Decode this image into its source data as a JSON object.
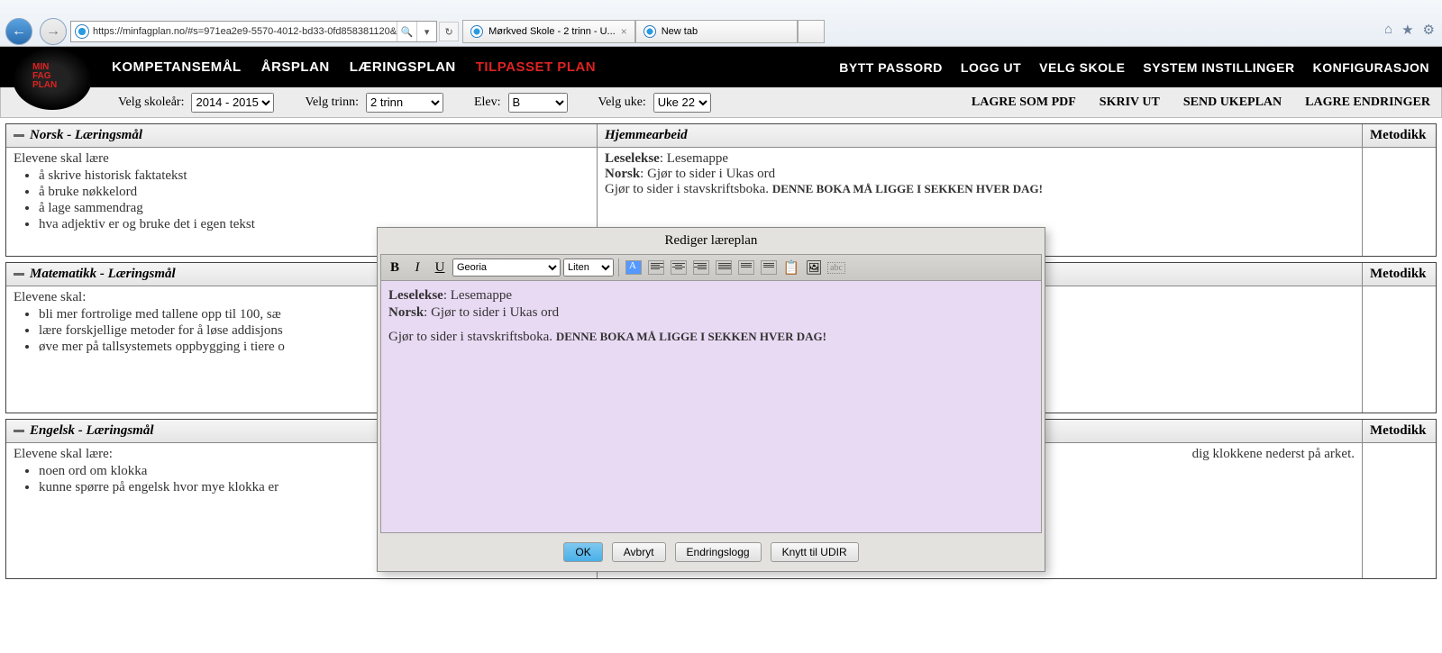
{
  "window": {
    "minimize": "–",
    "maximize": "❐",
    "close": "✕"
  },
  "browser": {
    "url": "https://minfagplan.no/#s=971ea2e9-5570-4012-bd33-0fd858381120&",
    "search_hint": "🔍",
    "tab1": "Mørkved Skole - 2 trinn - U...",
    "tab2": "New tab"
  },
  "nav": {
    "items": [
      "KOMPETANSEMÅL",
      "ÅRSPLAN",
      "LÆRINGSPLAN",
      "TILPASSET PLAN"
    ],
    "right": [
      "BYTT PASSORD",
      "LOGG UT",
      "VELG SKOLE",
      "SYSTEM INSTILLINGER",
      "KONFIGURASJON"
    ]
  },
  "filters": {
    "year_label": "Velg skoleår:",
    "year_value": "2014 - 2015",
    "trinn_label": "Velg trinn:",
    "trinn_value": "2 trinn",
    "elev_label": "Elev:",
    "elev_value": "B",
    "uke_label": "Velg uke:",
    "uke_value": "Uke 22",
    "right": [
      "LAGRE SOM PDF",
      "SKRIV UT",
      "SEND UKEPLAN",
      "LAGRE ENDRINGER"
    ]
  },
  "panels": {
    "norsk": {
      "title": "Norsk - Læringsmål",
      "hjemme": "Hjemmearbeid",
      "metodikk": "Metodikk",
      "intro": "Elevene skal lære",
      "items": [
        "å skrive historisk faktatekst",
        "å bruke nøkkelord",
        "å lage sammendrag",
        "hva adjektiv er og bruke det i egen tekst"
      ],
      "hjem_line1a": "Leselekse",
      "hjem_line1b": ": Lesemappe",
      "hjem_line2a": "Norsk",
      "hjem_line2b": ": Gjør to sider i Ukas ord",
      "hjem_line3a": "Gjør to sider i stavskriftsboka. ",
      "hjem_line3b": "DENNE BOKA MÅ LIGGE I SEKKEN HVER DAG!"
    },
    "matte": {
      "title": "Matematikk - Læringsmål",
      "metodikk": "Metodikk",
      "intro": "Elevene skal:",
      "items": [
        "bli mer fortrolige med tallene opp til 100, sæ",
        "lære forskjellige metoder for å løse addisjons",
        "øve mer på tallsystemets oppbygging i tiere o"
      ]
    },
    "engelsk": {
      "title": "Engelsk - Læringsmål",
      "metodikk": "Metodikk",
      "intro": "Elevene skal lære:",
      "items": [
        "noen ord om klokka",
        "kunne spørre på engelsk hvor mye klokka er "
      ],
      "right_frag": "dig klokkene nederst på arket."
    }
  },
  "modal": {
    "title": "Rediger læreplan",
    "font": "Georia",
    "size": "Liten",
    "line1a": "Leselekse",
    "line1b": ": Lesemappe",
    "line2a": "Norsk",
    "line2b": ": Gjør to sider i Ukas ord",
    "line3a": "Gjør to sider i stavskriftsboka. ",
    "line3b": "DENNE BOKA MÅ LIGGE I SEKKEN HVER DAG!",
    "buttons": {
      "ok": "OK",
      "cancel": "Avbryt",
      "log": "Endringslogg",
      "link": "Knytt til UDIR"
    }
  }
}
